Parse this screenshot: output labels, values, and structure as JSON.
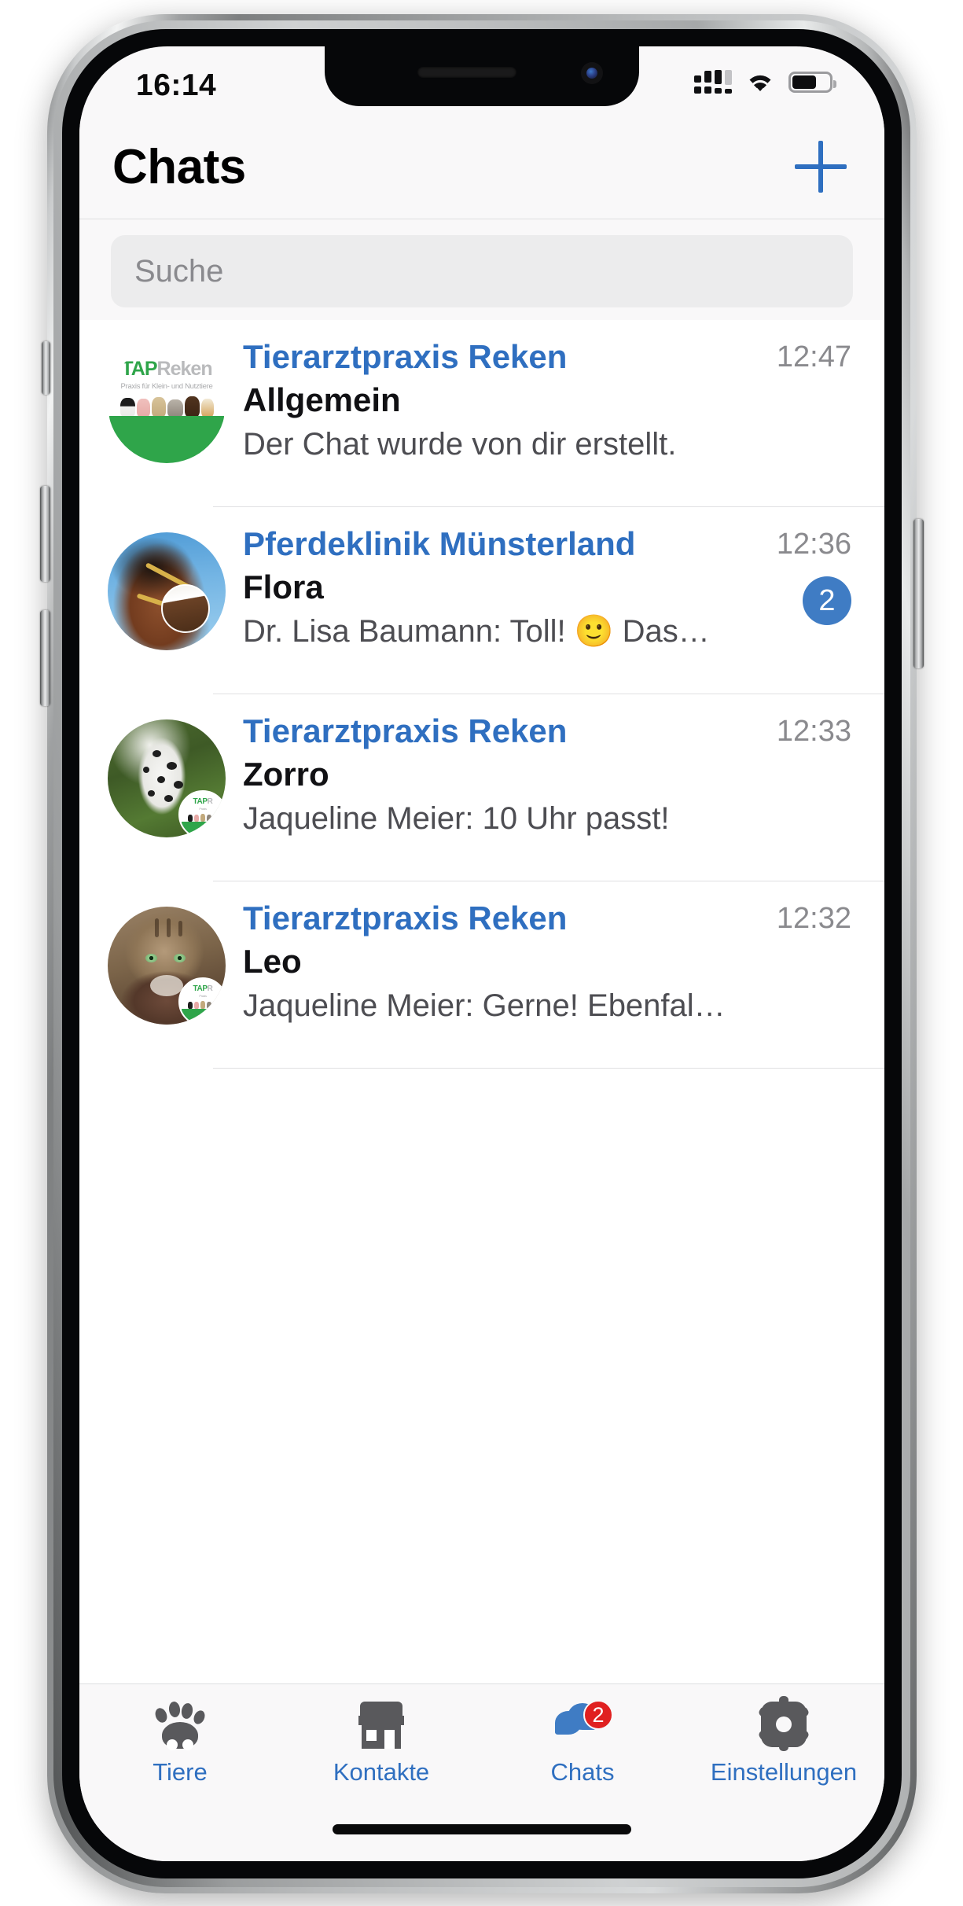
{
  "status_bar": {
    "time": "16:14",
    "signal_icon": "cellular-signal-icon",
    "wifi_icon": "wifi-icon",
    "battery_icon": "battery-icon",
    "battery_level_pct": 60
  },
  "navbar": {
    "title": "Chats",
    "add_icon": "plus-icon"
  },
  "search": {
    "placeholder": "Suche",
    "value": ""
  },
  "logo": {
    "tap": "TAP",
    "reken": "Reken",
    "tagline": "Praxis für Klein- und Nutztiere"
  },
  "chats": [
    {
      "organization": "Tierarztpraxis Reken",
      "pet": "Allgemein",
      "preview": "Der Chat wurde von dir erstellt.",
      "time": "12:47",
      "unread": "",
      "avatar": "tap-reken-logo"
    },
    {
      "organization": "Pferdeklinik Münsterland",
      "pet": "Flora",
      "preview": "Dr. Lisa Baumann: Toll! 🙂 Das…",
      "time": "12:36",
      "unread": "2",
      "avatar": "horse-photo"
    },
    {
      "organization": "Tierarztpraxis Reken",
      "pet": "Zorro",
      "preview": "Jaqueline Meier: 10 Uhr passt!",
      "time": "12:33",
      "unread": "",
      "avatar": "dalmatian-dog-photo"
    },
    {
      "organization": "Tierarztpraxis Reken",
      "pet": "Leo",
      "preview": "Jaqueline Meier: Gerne! Ebenfal…",
      "time": "12:32",
      "unread": "",
      "avatar": "tabby-cat-photo"
    }
  ],
  "tabbar": {
    "items": [
      {
        "label": "Tiere",
        "icon": "paw-icon",
        "badge": "",
        "active": false
      },
      {
        "label": "Kontakte",
        "icon": "store-icon",
        "badge": "",
        "active": false
      },
      {
        "label": "Chats",
        "icon": "chats-icon",
        "badge": "2",
        "active": true
      },
      {
        "label": "Einstellungen",
        "icon": "gear-icon",
        "badge": "",
        "active": false
      }
    ]
  },
  "colors": {
    "accent_blue": "#2f6fc0",
    "badge_blue": "#3f7cc4",
    "badge_red": "#e02020",
    "logo_green": "#2fa54a"
  }
}
